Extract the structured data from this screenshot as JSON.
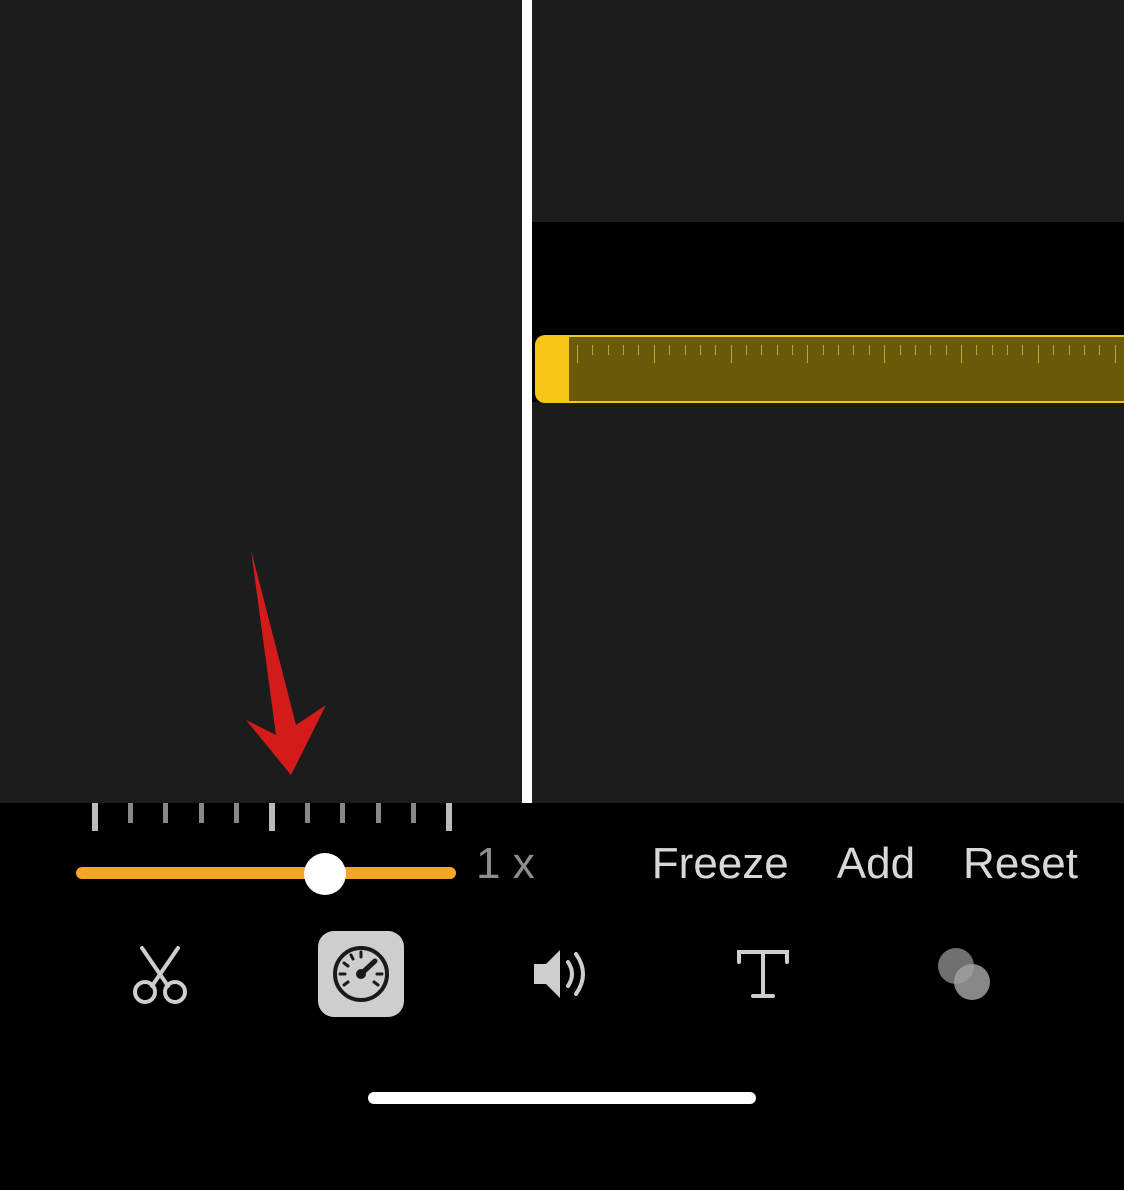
{
  "speed": {
    "value_label": "1 x",
    "slider_position_percent": 60
  },
  "actions": {
    "freeze": "Freeze",
    "add": "Add",
    "reset": "Reset"
  },
  "toolbar": {
    "items": [
      {
        "name": "cut",
        "icon": "scissors-icon",
        "selected": false
      },
      {
        "name": "speed",
        "icon": "speedometer-icon",
        "selected": true
      },
      {
        "name": "volume",
        "icon": "volume-icon",
        "selected": false
      },
      {
        "name": "text",
        "icon": "text-icon",
        "selected": false
      },
      {
        "name": "filters",
        "icon": "filters-icon",
        "selected": false
      }
    ]
  },
  "annotation": {
    "arrow_color": "#d41b1b"
  },
  "colors": {
    "accent_yellow": "#f5c518",
    "slider_orange": "#f5a623"
  }
}
